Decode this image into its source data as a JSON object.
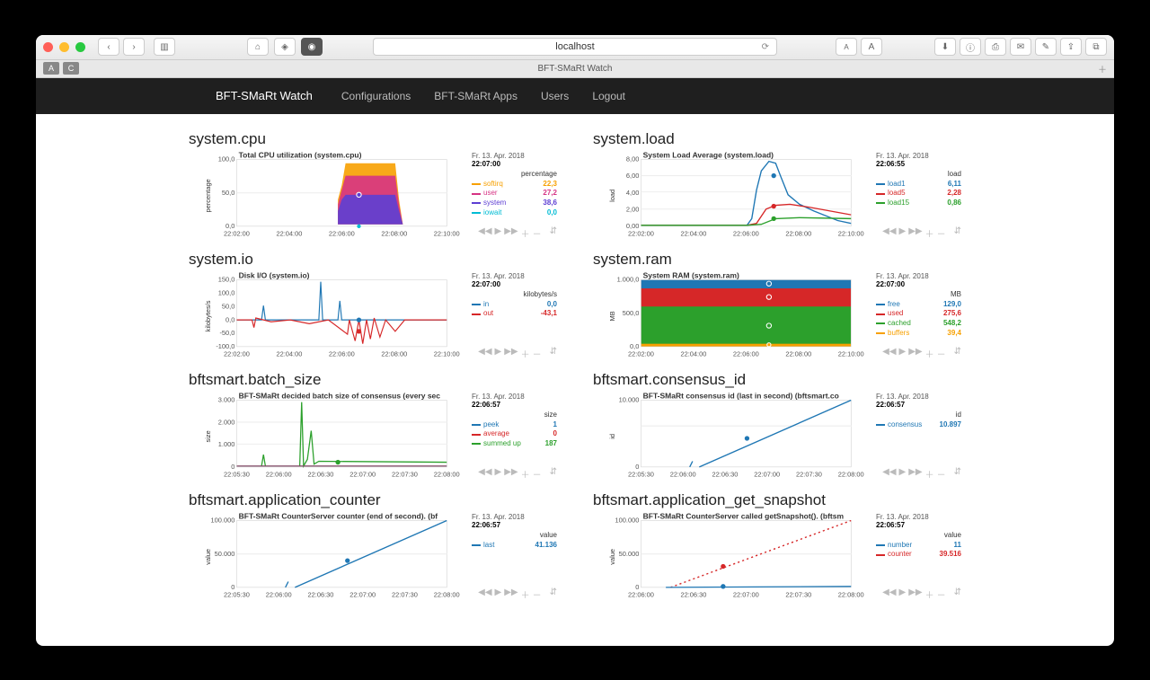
{
  "browser": {
    "url": "localhost",
    "tab_title": "BFT-SMaRt Watch"
  },
  "nav": {
    "brand": "BFT-SMaRt Watch",
    "links": [
      "Configurations",
      "BFT-SMaRt Apps",
      "Users",
      "Logout"
    ]
  },
  "charts": {
    "cpu": {
      "heading": "system.cpu",
      "title": "Total CPU utilization (system.cpu)",
      "yaxis_label": "percentage",
      "date": "Fr. 13. Apr. 2018",
      "time": "22:07:00",
      "unit": "percentage",
      "xticks": [
        "22:02:00",
        "22:04:00",
        "22:06:00",
        "22:08:00",
        "22:10:00"
      ],
      "yticks": [
        "0,0",
        "50,0",
        "100,0"
      ],
      "series": [
        {
          "name": "softirq",
          "value": "22,3",
          "color": "#f7a000"
        },
        {
          "name": "user",
          "value": "27,2",
          "color": "#d63384"
        },
        {
          "name": "system",
          "value": "38,6",
          "color": "#5d3fd3"
        },
        {
          "name": "iowait",
          "value": "0,0",
          "color": "#00bcd4"
        }
      ]
    },
    "load": {
      "heading": "system.load",
      "title": "System Load Average (system.load)",
      "yaxis_label": "load",
      "date": "Fr. 13. Apr. 2018",
      "time": "22:06:55",
      "unit": "load",
      "xticks": [
        "22:02:00",
        "22:04:00",
        "22:06:00",
        "22:08:00",
        "22:10:00"
      ],
      "yticks": [
        "0,00",
        "2,00",
        "4,00",
        "6,00",
        "8,00"
      ],
      "series": [
        {
          "name": "load1",
          "value": "6,11",
          "color": "#1f77b4"
        },
        {
          "name": "load5",
          "value": "2,28",
          "color": "#d62728"
        },
        {
          "name": "load15",
          "value": "0,86",
          "color": "#2ca02c"
        }
      ]
    },
    "io": {
      "heading": "system.io",
      "title": "Disk I/O (system.io)",
      "yaxis_label": "kilobytes/s",
      "date": "Fr. 13. Apr. 2018",
      "time": "22:07:00",
      "unit": "kilobytes/s",
      "xticks": [
        "22:02:00",
        "22:04:00",
        "22:06:00",
        "22:08:00",
        "22:10:00"
      ],
      "yticks": [
        "-100,0",
        "-50,0",
        "0,0",
        "50,0",
        "100,0",
        "150,0"
      ],
      "series": [
        {
          "name": "in",
          "value": "0,0",
          "color": "#1f77b4"
        },
        {
          "name": "out",
          "value": "-43,1",
          "color": "#d62728"
        }
      ]
    },
    "ram": {
      "heading": "system.ram",
      "title": "System RAM (system.ram)",
      "yaxis_label": "MB",
      "date": "Fr. 13. Apr. 2018",
      "time": "22:07:00",
      "unit": "MB",
      "xticks": [
        "22:02:00",
        "22:04:00",
        "22:06:00",
        "22:08:00",
        "22:10:00"
      ],
      "yticks": [
        "0,0",
        "500,0",
        "1.000,0"
      ],
      "series": [
        {
          "name": "free",
          "value": "129,0",
          "color": "#1f77b4"
        },
        {
          "name": "used",
          "value": "275,6",
          "color": "#d62728"
        },
        {
          "name": "cached",
          "value": "548,2",
          "color": "#2ca02c"
        },
        {
          "name": "buffers",
          "value": "39,4",
          "color": "#f7a000"
        }
      ]
    },
    "batch": {
      "heading": "bftsmart.batch_size",
      "title": "BFT-SMaRt decided batch size of consensus (every second). (bftsmart.batch_size)",
      "yaxis_label": "size",
      "date": "Fr. 13. Apr. 2018",
      "time": "22:06:57",
      "unit": "size",
      "xticks": [
        "22:05:30",
        "22:06:00",
        "22:06:30",
        "22:07:00",
        "22:07:30",
        "22:08:00"
      ],
      "yticks": [
        "0",
        "1.000",
        "2.000",
        "3.000"
      ],
      "series": [
        {
          "name": "peek",
          "value": "1",
          "color": "#1f77b4"
        },
        {
          "name": "average",
          "value": "0",
          "color": "#d62728"
        },
        {
          "name": "summed up",
          "value": "187",
          "color": "#2ca02c"
        }
      ]
    },
    "consensus": {
      "heading": "bftsmart.consensus_id",
      "title": "BFT-SMaRt consensus id (last in second) (bftsmart.consensus_id)",
      "yaxis_label": "id",
      "date": "Fr. 13. Apr. 2018",
      "time": "22:06:57",
      "unit": "id",
      "xticks": [
        "22:05:30",
        "22:06:00",
        "22:06:30",
        "22:07:00",
        "22:07:30",
        "22:08:00"
      ],
      "yticks": [
        "0",
        "10.000"
      ],
      "series": [
        {
          "name": "consensus",
          "value": "10.897",
          "color": "#1f77b4"
        }
      ]
    },
    "counter": {
      "heading": "bftsmart.application_counter",
      "title": "BFT-SMaRt CounterServer counter (end of second). (bftsmart.counter)",
      "yaxis_label": "value",
      "date": "Fr. 13. Apr. 2018",
      "time": "22:06:57",
      "unit": "value",
      "xticks": [
        "22:05:30",
        "22:06:00",
        "22:06:30",
        "22:07:00",
        "22:07:30",
        "22:08:00"
      ],
      "yticks": [
        "0",
        "50.000",
        "100.000"
      ],
      "series": [
        {
          "name": "last",
          "value": "41.136",
          "color": "#1f77b4"
        }
      ]
    },
    "snapshot": {
      "heading": "bftsmart.application_get_snapshot",
      "title": "BFT-SMaRt CounterServer called getSnapshot(). (bftsmart.getSnapshot)",
      "yaxis_label": "value",
      "date": "Fr. 13. Apr. 2018",
      "time": "22:06:57",
      "unit": "value",
      "xticks": [
        "22:06:00",
        "22:06:30",
        "22:07:00",
        "22:07:30",
        "22:08:00"
      ],
      "yticks": [
        "0",
        "50.000",
        "100.000"
      ],
      "series": [
        {
          "name": "number",
          "value": "11",
          "color": "#1f77b4"
        },
        {
          "name": "counter",
          "value": "39.516",
          "color": "#d62728"
        }
      ]
    }
  },
  "chart_data": [
    {
      "id": "cpu",
      "type": "area",
      "stacked": true,
      "title": "Total CPU utilization (system.cpu)",
      "xlabel": "",
      "ylabel": "percentage",
      "ylim": [
        0,
        100
      ],
      "x_range": [
        "22:01:00",
        "22:11:00"
      ],
      "series": [
        {
          "name": "softirq",
          "color": "#f7a000"
        },
        {
          "name": "user",
          "color": "#d63384"
        },
        {
          "name": "system",
          "color": "#5d3fd3"
        },
        {
          "name": "iowait",
          "color": "#00bcd4"
        }
      ],
      "approx_segments": [
        {
          "t": "22:01:00-22:05:30",
          "total": 2
        },
        {
          "t": "22:05:30-22:08:30",
          "total": 95,
          "softirq": 22.3,
          "user": 27.2,
          "system": 38.6,
          "iowait": 0.0
        },
        {
          "t": "22:08:30-22:11:00",
          "total": 2
        }
      ]
    },
    {
      "id": "load",
      "type": "line",
      "title": "System Load Average (system.load)",
      "xlabel": "",
      "ylabel": "load",
      "ylim": [
        0,
        8
      ],
      "x_range": [
        "22:01:00",
        "22:11:00"
      ],
      "series": [
        {
          "name": "load1",
          "color": "#1f77b4",
          "peak_time": "22:06:30",
          "peak": 8.0,
          "at_22:06:55": 6.11
        },
        {
          "name": "load5",
          "color": "#d62728",
          "at_22:06:55": 2.28
        },
        {
          "name": "load15",
          "color": "#2ca02c",
          "at_22:06:55": 0.86
        }
      ]
    },
    {
      "id": "io",
      "type": "line",
      "title": "Disk I/O (system.io)",
      "xlabel": "",
      "ylabel": "kilobytes/s",
      "ylim": [
        -100,
        150
      ],
      "x_range": [
        "22:01:00",
        "22:11:00"
      ],
      "series": [
        {
          "name": "in",
          "color": "#1f77b4",
          "at_22:07:00": 0.0
        },
        {
          "name": "out",
          "color": "#d62728",
          "at_22:07:00": -43.1
        }
      ]
    },
    {
      "id": "ram",
      "type": "area",
      "stacked": true,
      "title": "System RAM (system.ram)",
      "xlabel": "",
      "ylabel": "MB",
      "ylim": [
        0,
        1000
      ],
      "x_range": [
        "22:01:00",
        "22:11:00"
      ],
      "series": [
        {
          "name": "free",
          "color": "#1f77b4",
          "value": 129.0
        },
        {
          "name": "used",
          "color": "#d62728",
          "value": 275.6
        },
        {
          "name": "cached",
          "color": "#2ca02c",
          "value": 548.2
        },
        {
          "name": "buffers",
          "color": "#f7a000",
          "value": 39.4
        }
      ]
    },
    {
      "id": "batch",
      "type": "line",
      "title": "BFT-SMaRt decided batch size of consensus (every second).",
      "ylabel": "size",
      "ylim": [
        0,
        3200
      ],
      "x_range": [
        "22:05:15",
        "22:08:15"
      ],
      "series": [
        {
          "name": "peek",
          "color": "#1f77b4",
          "at_22:06:57": 1
        },
        {
          "name": "average",
          "color": "#d62728",
          "at_22:06:57": 0
        },
        {
          "name": "summed up",
          "color": "#2ca02c",
          "spike_time": "22:06:30",
          "spike": 3200,
          "at_22:06:57": 187
        }
      ]
    },
    {
      "id": "consensus",
      "type": "line",
      "title": "BFT-SMaRt consensus id (last in second)",
      "ylabel": "id",
      "ylim": [
        0,
        14000
      ],
      "x_range": [
        "22:05:15",
        "22:08:15"
      ],
      "series": [
        {
          "name": "consensus",
          "color": "#1f77b4",
          "points": [
            [
              "22:06:10",
              0
            ],
            [
              "22:08:10",
              14000
            ]
          ],
          "at_22:06:57": 10897
        }
      ]
    },
    {
      "id": "counter",
      "type": "line",
      "title": "BFT-SMaRt CounterServer counter (end of second).",
      "ylabel": "value",
      "ylim": [
        0,
        100000
      ],
      "x_range": [
        "22:05:15",
        "22:08:15"
      ],
      "series": [
        {
          "name": "last",
          "color": "#1f77b4",
          "points": [
            [
              "22:06:10",
              0
            ],
            [
              "22:08:10",
              100000
            ]
          ],
          "at_22:06:57": 41136
        }
      ]
    },
    {
      "id": "snapshot",
      "type": "line",
      "title": "BFT-SMaRt CounterServer called getSnapshot().",
      "ylabel": "value",
      "ylim": [
        0,
        100000
      ],
      "x_range": [
        "22:05:45",
        "22:08:15"
      ],
      "series": [
        {
          "name": "number",
          "color": "#1f77b4",
          "at_22:06:57": 11
        },
        {
          "name": "counter",
          "color": "#d62728",
          "style": "dotted",
          "points": [
            [
              "22:06:20",
              0
            ],
            [
              "22:08:10",
              100000
            ]
          ],
          "at_22:06:57": 39516
        }
      ]
    }
  ]
}
